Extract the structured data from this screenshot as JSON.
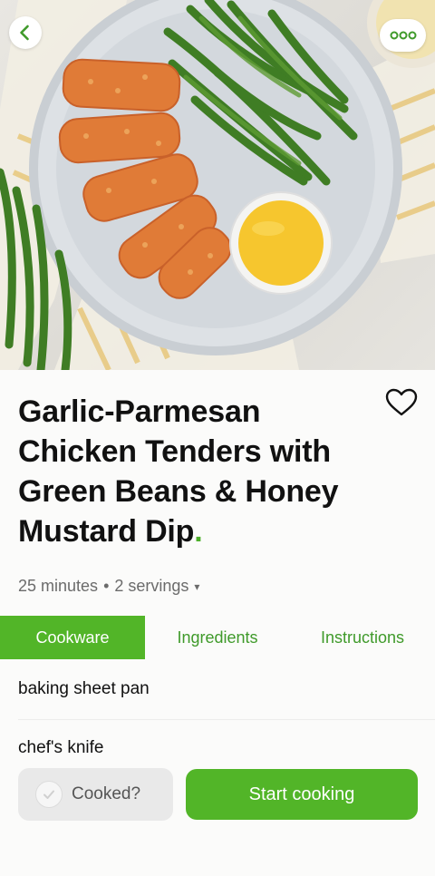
{
  "header": {
    "back_icon": "chevron-left-icon",
    "more_icon": "more-dots-icon"
  },
  "recipe": {
    "title": "Garlic-Parmesan Chicken Tenders with Green Beans & Honey Mustard Dip",
    "title_suffix": ".",
    "duration": "25 minutes",
    "separator": "•",
    "servings": "2 servings",
    "servings_caret": "▾",
    "favorite_icon": "heart-icon"
  },
  "tabs": [
    {
      "label": "Cookware",
      "active": true
    },
    {
      "label": "Ingredients",
      "active": false
    },
    {
      "label": "Instructions",
      "active": false
    }
  ],
  "cookware": [
    "baking sheet pan",
    "chef's knife"
  ],
  "actions": {
    "cooked_label": "Cooked?",
    "start_label": "Start cooking"
  },
  "colors": {
    "accent_green": "#52b528",
    "tab_text_green": "#3f9a2a",
    "title_dot_green": "#4caf2a"
  }
}
